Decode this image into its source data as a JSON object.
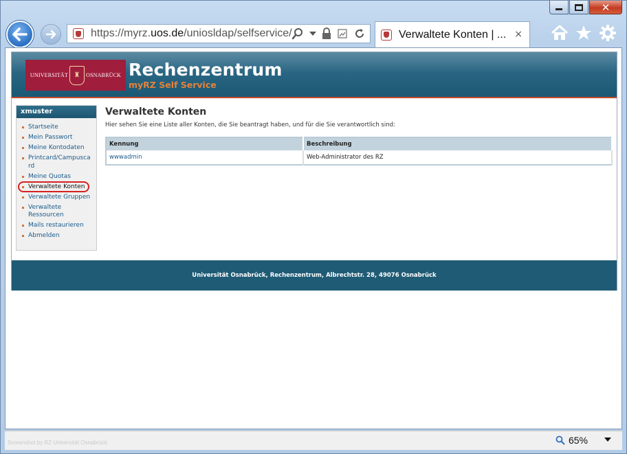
{
  "browser": {
    "url_prefix": "https://myrz.",
    "url_domain": "uos.de",
    "url_path": "/uniosldap/selfservice/",
    "tab_title": "Verwaltete Konten | ...",
    "tab_close": "×",
    "zoom_level": "65%",
    "icons": [
      "back-icon",
      "forward-icon",
      "search-icon",
      "dropdown-icon",
      "lock-icon",
      "compat-icon",
      "refresh-icon",
      "home-icon",
      "favorites-icon",
      "settings-icon"
    ]
  },
  "site": {
    "logo_left": "UNIVERSITÄT",
    "logo_right": "OSNABRÜCK",
    "title": "Rechenzentrum",
    "subtitle": "myRZ Self Service"
  },
  "sidebar": {
    "username": "xmuster",
    "items": [
      {
        "label": "Startseite"
      },
      {
        "label": "Mein Passwort"
      },
      {
        "label": "Meine Kontodaten"
      },
      {
        "label": "Printcard/Campuscard"
      },
      {
        "label": "Meine Quotas"
      },
      {
        "label": "Verwaltete Konten"
      },
      {
        "label": "Verwaltete Gruppen"
      },
      {
        "label": "Verwaltete Ressourcen"
      },
      {
        "label": "Mails restaurieren"
      },
      {
        "label": "Abmelden"
      }
    ]
  },
  "main": {
    "heading": "Verwaltete Konten",
    "intro": "Hier sehen Sie eine Liste aller Konten, die Sie beantragt haben, und für die Sie verantwortlich sind:",
    "table": {
      "headers": [
        "Kennung",
        "Beschreibung"
      ],
      "rows": [
        {
          "kennung": "wwwadmin",
          "beschreibung": "Web-Administrator des RZ"
        }
      ]
    }
  },
  "footer": {
    "text": "Universität Osnabrück, Rechenzentrum, Albrechtstr. 28, 49076 Osnabrück"
  },
  "statusbar": {
    "watermark": "Screenshot by RZ Universität Osnabrück"
  },
  "colors": {
    "header": "#1f5b75",
    "accent_orange": "#e6823a",
    "logo_red": "#a01d3c",
    "highlight_ring": "#d62020"
  }
}
